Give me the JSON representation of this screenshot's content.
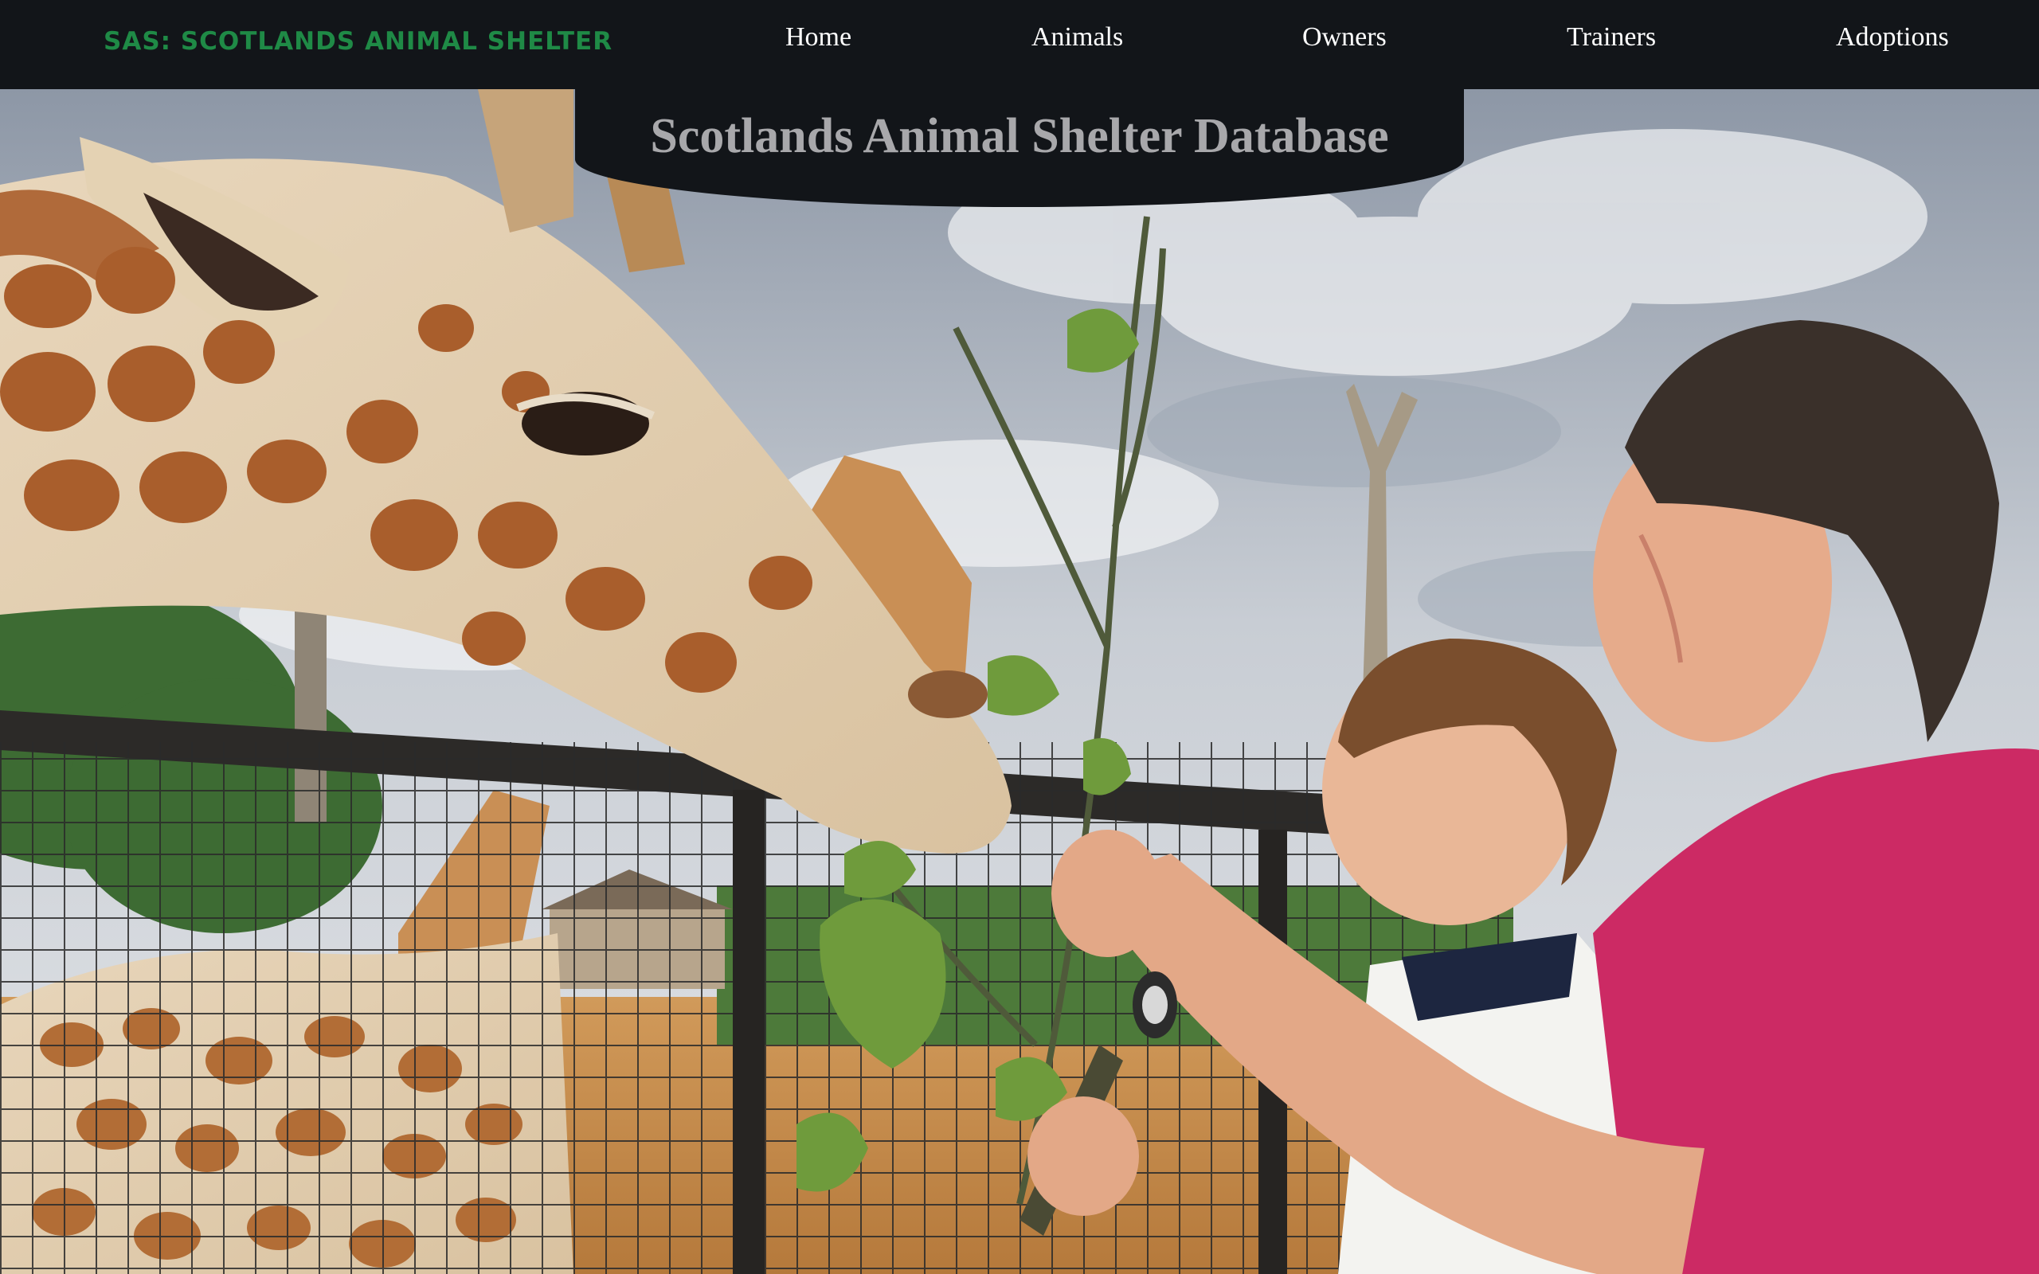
{
  "navbar": {
    "brand": "SAS: Scotlands Animal Shelter",
    "items": [
      "Home",
      "Animals",
      "Owners",
      "Trainers",
      "Adoptions"
    ]
  },
  "hero": {
    "title": "Scotlands Animal Shelter Database"
  },
  "colors": {
    "navbar_bg": "#121519",
    "brand": "#1f8a46",
    "nav_text": "#ffffff",
    "title_text": "#a8a8ab"
  }
}
